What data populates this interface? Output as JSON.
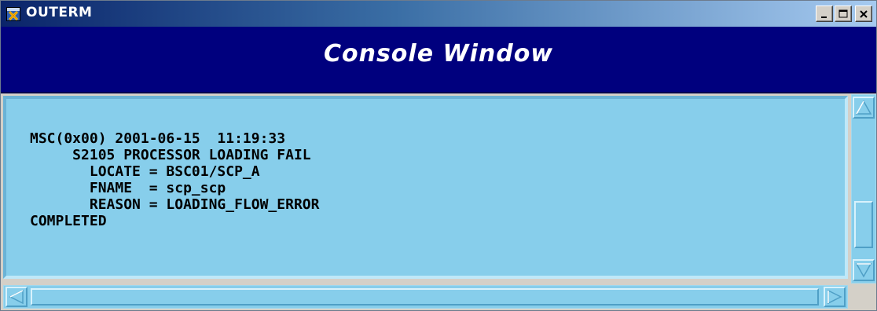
{
  "window": {
    "title": "OUTERM",
    "icon": "x-window-icon"
  },
  "controls": {
    "minimize_icon": "minimize-icon",
    "maximize_icon": "maximize-icon",
    "close_icon": "close-icon"
  },
  "header": {
    "title": "Console Window"
  },
  "console": {
    "lines": [
      "MSC(0x00) 2001-06-15  11:19:33",
      "     S2105 PROCESSOR LOADING FAIL",
      "       LOCATE = BSC01/SCP_A",
      "       FNAME  = scp_scp",
      "       REASON = LOADING_FLOW_ERROR",
      "COMPLETED"
    ]
  },
  "colors": {
    "header_bg": "#00007e",
    "console_bg": "#87ceeb",
    "titlebar_start": "#0a246a",
    "titlebar_end": "#a6caf0"
  }
}
